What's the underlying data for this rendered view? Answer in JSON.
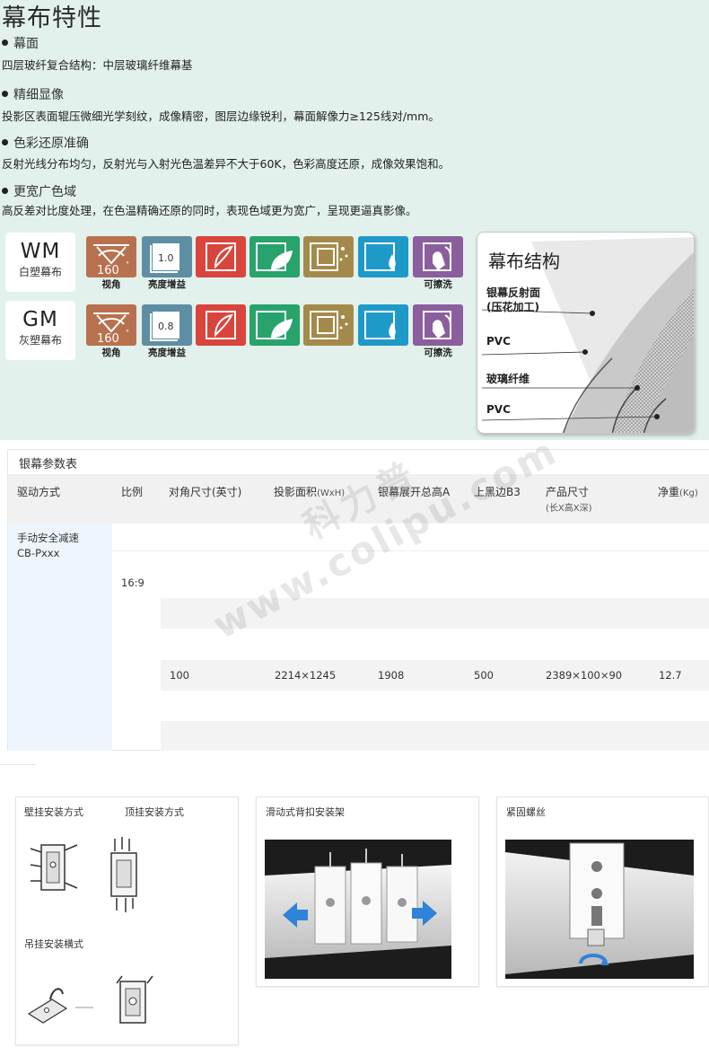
{
  "features": {
    "title": "幕布特性",
    "items": [
      {
        "heading": "幕面",
        "text": "四层玻纤复合结构：中层玻璃纤维幕基"
      },
      {
        "heading": "精细显像",
        "text": "投影区表面辊压微细光学刻纹，成像精密，图层边缘锐利，幕面解像力≥125线对/mm。"
      },
      {
        "heading": "色彩还原准确",
        "text": "反射光线分布均匀，反射光与入射光色温差异不大于60K，色彩高度还原，成像效果饱和。"
      },
      {
        "heading": "更宽广色域",
        "text": "高反差对比度处理，在色温精确还原的同时，表现色域更为宽广，呈现更逼真影像。"
      }
    ]
  },
  "products": [
    {
      "code": "WM",
      "name": "白塑幕布",
      "angle": "160",
      "gain": "1.0"
    },
    {
      "code": "GM",
      "name": "灰塑幕布",
      "angle": "160",
      "gain": "0.8"
    }
  ],
  "tile_labels": {
    "view_angle": "视角",
    "gain": "亮度增益",
    "washable": "可擦洗"
  },
  "tile_colors": [
    "#b8714e",
    "#5d8ea3",
    "#d9453c",
    "#27a36b",
    "#a48a4a",
    "#1e9ac9",
    "#8b5e9e"
  ],
  "tile_icons": [
    "view-angle-icon",
    "gain-icon",
    "color-icon",
    "eco-leaf-icon",
    "sparkle-screen-icon",
    "water-drop-icon",
    "wipe-hand-icon"
  ],
  "structure": {
    "title": "幕布结构",
    "layer1": "银幕反射面",
    "layer1_note": "(压花加工)",
    "layer2": "PVC",
    "layer3": "玻璃纤维",
    "layer4": "PVC"
  },
  "params": {
    "caption": "银幕参数表",
    "headers": {
      "drive": "驱动方式",
      "ratio": "比例",
      "diag": "对角尺寸(英寸)",
      "area": "投影面积",
      "area_unit": "(WxH)",
      "height": "银幕展开总高A",
      "top_black": "上黑边B3",
      "size": "产品尺寸",
      "size_unit": "(长X高X深)",
      "weight": "净重",
      "weight_unit": "(Kg)"
    },
    "drive_name": "手动安全减速",
    "drive_model": "CB-Pxxx",
    "ratio": "16:9",
    "row": {
      "diag": "100",
      "area": "2214×1245",
      "height": "1908",
      "top_black": "500",
      "size": "2389×100×90",
      "weight": "12.7"
    }
  },
  "install": {
    "wall": "壁挂安装方式",
    "ceiling": "顶挂安装方式",
    "hanging": "吊挂安装横式",
    "slide": "滑动式背扣安装架",
    "screw": "紧固螺丝"
  },
  "watermark": {
    "brand": "科力普",
    "url": "www.colipu.com"
  }
}
